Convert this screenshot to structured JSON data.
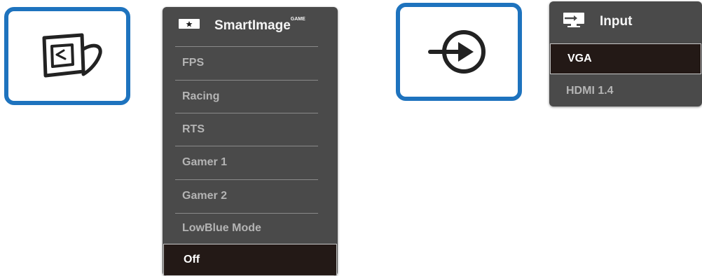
{
  "smartimage": {
    "title": "SmartImage",
    "title_mark": "GAME",
    "items": [
      {
        "label": "FPS"
      },
      {
        "label": "Racing"
      },
      {
        "label": "RTS"
      },
      {
        "label": "Gamer 1"
      },
      {
        "label": "Gamer 2"
      },
      {
        "label": "LowBlue Mode"
      },
      {
        "label": "Off"
      }
    ],
    "selected": "Off"
  },
  "input": {
    "title": "Input",
    "items": [
      {
        "label": "VGA"
      },
      {
        "label": "HDMI 1.4"
      }
    ],
    "selected": "VGA"
  },
  "colors": {
    "button_border": "#1e73be",
    "menu_bg": "#4a4a4a",
    "selected_bg": "#231916",
    "inactive_text": "#b4b4b4"
  },
  "icons": {
    "smartimage_button": "smartimage-icon",
    "input_button": "input-arrow-icon",
    "smartimage_header": "star-icon",
    "input_header": "monitor-input-icon"
  }
}
